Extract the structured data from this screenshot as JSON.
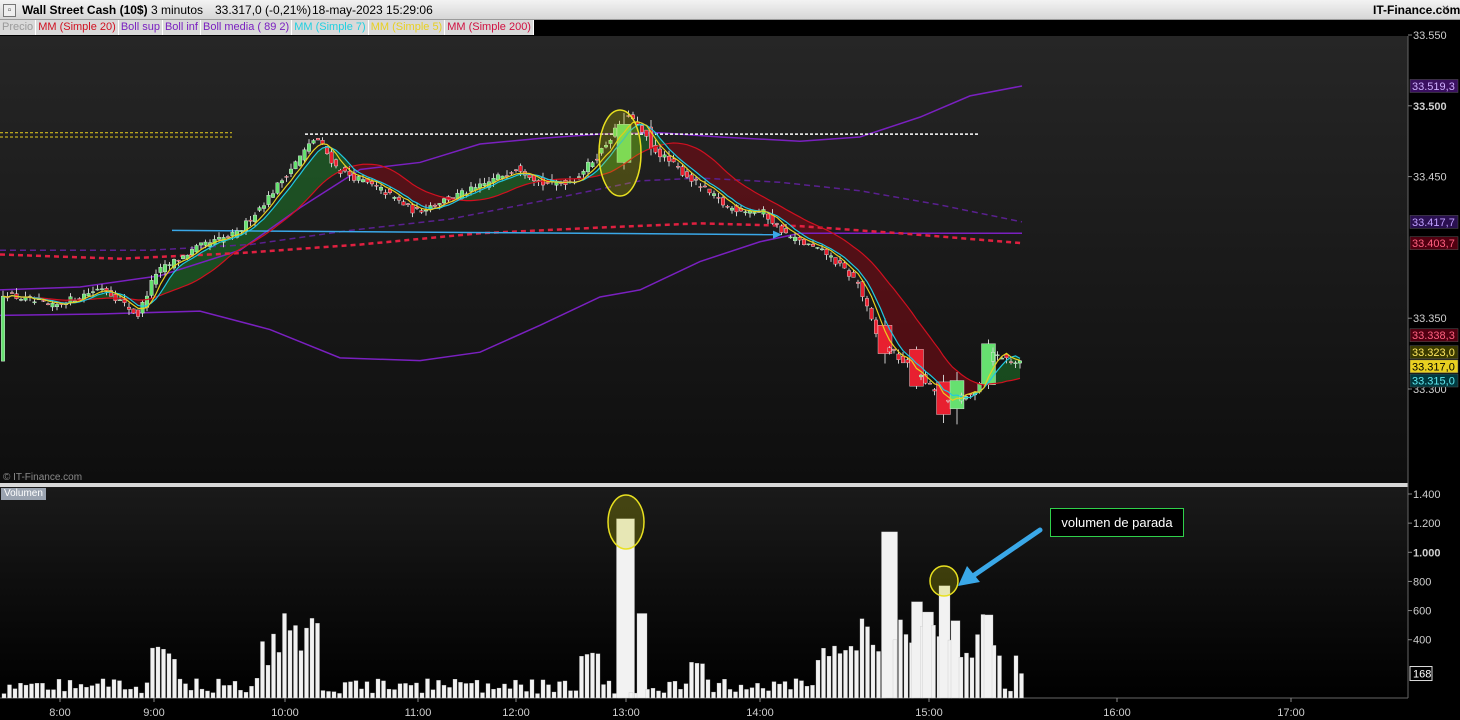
{
  "titlebar": {
    "instrument": "Wall Street Cash (10$)",
    "timeframe": "3 minutos",
    "quote": "33.317,0 (-0,21%)",
    "datetime": "18-may-2023 15:29:06",
    "brand": "IT-Finance.com"
  },
  "legend": [
    {
      "label": "Precio",
      "color": "#9a9a9a"
    },
    {
      "label": "MM (Simple 20)",
      "color": "#d01020"
    },
    {
      "label": "Boll sup",
      "color": "#7a20c0"
    },
    {
      "label": "Boll inf",
      "color": "#7a20c0"
    },
    {
      "label": "Boll media ( 89 2)",
      "color": "#7a20c0"
    },
    {
      "label": "MM (Simple 7)",
      "color": "#20d0e0"
    },
    {
      "label": "MM (Simple 5)",
      "color": "#e8d020"
    },
    {
      "label": "MM (Simple 200)",
      "color": "#d01040"
    }
  ],
  "copyright": "© IT-Finance.com",
  "volume_tab": "Volumen",
  "annotation": "volumen de parada",
  "colors": {
    "up": "#66e070",
    "down": "#e82030",
    "ma20": "#d01020",
    "boll": "#7a20c0",
    "ma7": "#20c8e0",
    "ma5": "#e8d020",
    "ma200": "#e02040",
    "arrow": "#3aa8e8",
    "highlight": "#e8e020"
  },
  "chart_data": [
    {
      "type": "candlestick",
      "x_ticks": [
        "8:00",
        "9:00",
        "10:00",
        "11:00",
        "12:00",
        "13:00",
        "14:00",
        "15:00",
        "16:00",
        "17:00"
      ],
      "y_ticks": [
        "33.550",
        "33.500",
        "33.450",
        "33.350",
        "33.300"
      ],
      "ylim": [
        33260,
        33560
      ],
      "price_tags": [
        {
          "label": "33.519,3",
          "value": 33514,
          "bg": "#3a1060",
          "fg": "#d0b0ff"
        },
        {
          "label": "33.417,7",
          "value": 33418,
          "bg": "#2a1050",
          "fg": "#c0a0ff"
        },
        {
          "label": "33.403,7",
          "value": 33403,
          "bg": "#500010",
          "fg": "#ff6080"
        },
        {
          "label": "33.338,3",
          "value": 33338,
          "bg": "#500010",
          "fg": "#ff6080"
        },
        {
          "label": "33.323,0",
          "value": 33326,
          "bg": "#3a3a00",
          "fg": "#ffe860"
        },
        {
          "label": "33.317,0",
          "value": 33316,
          "bg": "#e8d020",
          "fg": "#000000"
        },
        {
          "label": "33.315,0",
          "value": 33306,
          "bg": "#003a40",
          "fg": "#60e8f0"
        }
      ]
    },
    {
      "type": "bar",
      "series_name": "Volumen",
      "y_ticks": [
        "1.400",
        "1.200",
        "1.000",
        "800",
        "600",
        "400"
      ],
      "ylim": [
        0,
        1400
      ],
      "last_value_tag": "168",
      "last_value": 168
    }
  ]
}
